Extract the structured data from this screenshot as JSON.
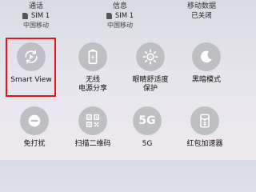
{
  "status": {
    "calls": {
      "label": "通话",
      "sim": "SIM 1",
      "carrier": "中国移动"
    },
    "messages": {
      "label": "信息",
      "sim": "SIM 1",
      "carrier": "中国移动"
    },
    "mobile_data": {
      "label": "移动数据",
      "state": "已关闭"
    }
  },
  "toggles": {
    "smart_view": {
      "label": "Smart View",
      "icon": "smart-view-icon"
    },
    "wireless_powershare": {
      "label_line1": "无线",
      "label_line2": "电源分享",
      "icon": "battery-share-icon"
    },
    "eye_comfort": {
      "label_line1": "眼睛舒适度",
      "label_line2": "保护",
      "icon": "eye-comfort-icon"
    },
    "dark_mode": {
      "label": "黑暗模式",
      "icon": "moon-icon"
    },
    "do_not_disturb": {
      "label": "免打扰",
      "icon": "dnd-icon"
    },
    "scan_qr": {
      "label": "扫描二维码",
      "icon": "qr-code-icon"
    },
    "five_g": {
      "label": "5G",
      "icon_text": "5G"
    },
    "red_packet": {
      "label": "红包加速器",
      "icon": "red-packet-icon"
    }
  },
  "colors": {
    "highlight": "#e0171f",
    "tile_bg": "#bebfc3",
    "icon": "#ffffff"
  }
}
